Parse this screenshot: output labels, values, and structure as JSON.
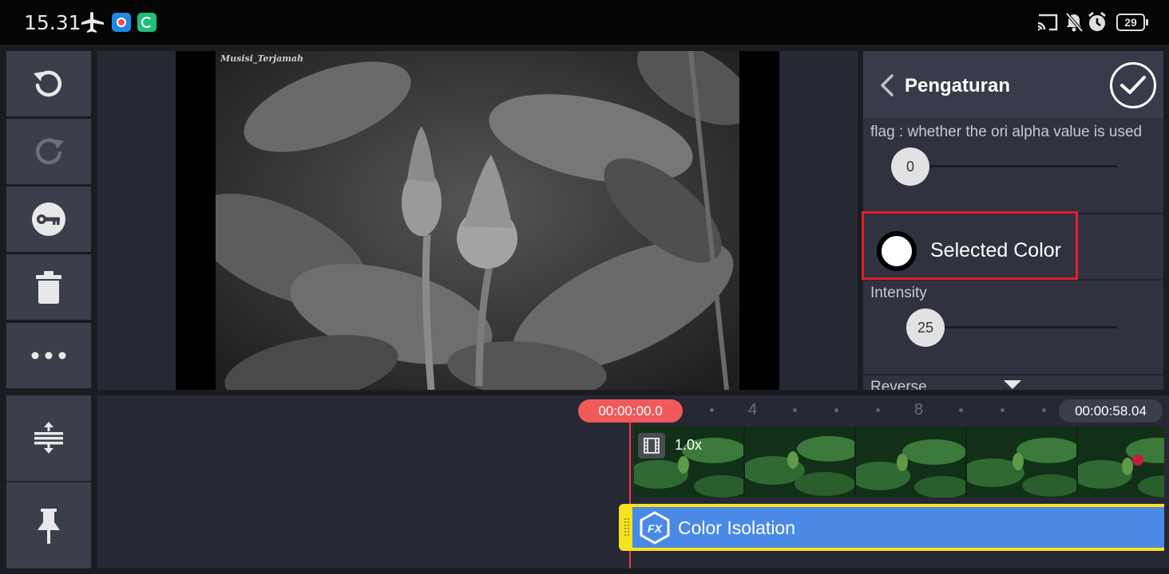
{
  "status_bar": {
    "time": "15.31",
    "battery": "29",
    "icons": [
      "airplane-icon",
      "screen-record-icon",
      "sync-app-icon",
      "cast-icon",
      "notifications-off-icon",
      "alarm-icon",
      "battery-icon"
    ]
  },
  "toolbar": {
    "icons": [
      "undo-icon",
      "redo-icon",
      "keyframe-key-icon",
      "trash-icon",
      "more-icon"
    ],
    "lower_icons": [
      "fit-timeline-icon",
      "pin-icon"
    ]
  },
  "preview": {
    "watermark": "Musisi_Terjamah"
  },
  "panel": {
    "title": "Pengaturan",
    "flag_label": "flag : whether the ori alpha value is used",
    "flag_value": "0",
    "selected_color_label": "Selected Color",
    "selected_color": "#ffffff",
    "intensity_label": "Intensity",
    "intensity_value": "25",
    "reverse_label": "Reverse"
  },
  "timeline": {
    "current_time": "00:00:00.0",
    "total_time": "00:00:58.04",
    "ruler_labels": [
      "4",
      "8"
    ],
    "clip_speed": "1.0x",
    "effect_name": "Color Isolation"
  },
  "colors": {
    "accent_red": "#e0222a",
    "playhead": "#f15a5a",
    "effect_clip": "#4a8ae6",
    "effect_border": "#f5e320"
  }
}
